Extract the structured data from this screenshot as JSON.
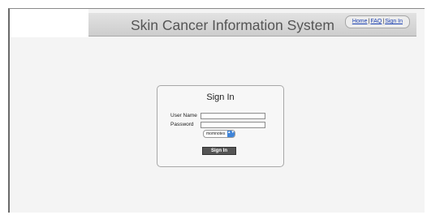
{
  "header": {
    "title": "Skin Cancer Information System",
    "nav": {
      "home": "Home",
      "faq": "FAQ",
      "signin": "Sign In",
      "separator": "|"
    }
  },
  "signin_form": {
    "title": "Sign In",
    "username_label": "User Name",
    "password_label": "Password",
    "username_value": "",
    "password_value": "",
    "domain_select": {
      "selected": "momnotes",
      "arrow_glyphs": "▲▼"
    },
    "submit_label": "Sign In"
  },
  "colors": {
    "header_bar": "#d6d6d6",
    "link": "#1a3fb0",
    "button_bg": "#555555",
    "select_arrow": "#3f84d8"
  }
}
